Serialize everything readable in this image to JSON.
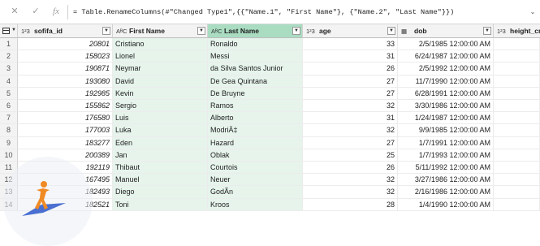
{
  "formula_bar": {
    "cancel_glyph": "✕",
    "confirm_glyph": "✓",
    "fx_label": "fx",
    "formula": "= Table.RenameColumns(#\"Changed Type1\",{{\"Name.1\", \"First Name\"}, {\"Name.2\", \"Last Name\"}})",
    "expand_glyph": "⌄"
  },
  "columns": [
    {
      "type": "1²3",
      "name": "sofifa_id"
    },
    {
      "type": "AᴮC",
      "name": "First Name"
    },
    {
      "type": "AᴮC",
      "name": "Last Name"
    },
    {
      "type": "1²3",
      "name": "age"
    },
    {
      "type": "▦",
      "name": "dob"
    },
    {
      "type": "1²3",
      "name": "height_cm"
    }
  ],
  "rows": [
    {
      "n": "1",
      "id": "20801",
      "first": "Cristiano",
      "last": "Ronaldo",
      "age": "33",
      "dob": "2/5/1985 12:00:00 AM"
    },
    {
      "n": "2",
      "id": "158023",
      "first": "Lionel",
      "last": "Messi",
      "age": "31",
      "dob": "6/24/1987 12:00:00 AM"
    },
    {
      "n": "3",
      "id": "190871",
      "first": "Neymar",
      "last": "da Silva Santos Junior",
      "age": "26",
      "dob": "2/5/1992 12:00:00 AM"
    },
    {
      "n": "4",
      "id": "193080",
      "first": "David",
      "last": "De Gea Quintana",
      "age": "27",
      "dob": "11/7/1990 12:00:00 AM"
    },
    {
      "n": "5",
      "id": "192985",
      "first": "Kevin",
      "last": "De Bruyne",
      "age": "27",
      "dob": "6/28/1991 12:00:00 AM"
    },
    {
      "n": "6",
      "id": "155862",
      "first": "Sergio",
      "last": "Ramos",
      "age": "32",
      "dob": "3/30/1986 12:00:00 AM"
    },
    {
      "n": "7",
      "id": "176580",
      "first": "Luis",
      "last": "Alberto",
      "age": "31",
      "dob": "1/24/1987 12:00:00 AM"
    },
    {
      "n": "8",
      "id": "177003",
      "first": "Luka",
      "last": "ModriÄ‡",
      "age": "32",
      "dob": "9/9/1985 12:00:00 AM"
    },
    {
      "n": "9",
      "id": "183277",
      "first": "Eden",
      "last": "Hazard",
      "age": "27",
      "dob": "1/7/1991 12:00:00 AM"
    },
    {
      "n": "10",
      "id": "200389",
      "first": "Jan",
      "last": "Oblak",
      "age": "25",
      "dob": "1/7/1993 12:00:00 AM"
    },
    {
      "n": "11",
      "id": "192119",
      "first": "Thibaut",
      "last": "Courtois",
      "age": "26",
      "dob": "5/11/1992 12:00:00 AM"
    },
    {
      "n": "12",
      "id": "167495",
      "first": "Manuel",
      "last": "Neuer",
      "age": "32",
      "dob": "3/27/1986 12:00:00 AM"
    },
    {
      "n": "13",
      "id": "182493",
      "first": "Diego",
      "last": "GodÃn",
      "age": "32",
      "dob": "2/16/1986 12:00:00 AM"
    },
    {
      "n": "14",
      "id": "182521",
      "first": "Toni",
      "last": "Kroos",
      "age": "28",
      "dob": "1/4/1990 12:00:00 AM"
    }
  ],
  "colors": {
    "selected_column": "#a9dcc1",
    "selected_cells": "#e6f4ec",
    "header_bg": "#f3f3f3"
  },
  "icons": [
    "close-icon",
    "check-icon",
    "fx-icon",
    "expand-icon",
    "table-menu-icon",
    "dropdown-icon",
    "column-type-icon"
  ]
}
